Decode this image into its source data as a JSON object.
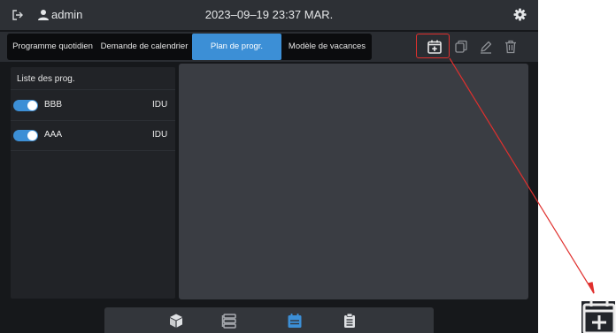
{
  "header": {
    "username": "admin",
    "datetime": "2023–09–19 23:37 MAR."
  },
  "tabs": [
    {
      "label": "Programme quotidien"
    },
    {
      "label": "Demande de calendrier"
    },
    {
      "label": "Plan de progr.",
      "active": true
    },
    {
      "label": "Modèle de vacances"
    }
  ],
  "toolbar": {
    "icons": [
      "calendar-add-icon",
      "copy-icon",
      "edit-icon",
      "delete-icon"
    ],
    "highlighted": "calendar-add-icon"
  },
  "program_list": {
    "title": "Liste des prog.",
    "items": [
      {
        "name": "BBB",
        "type": "IDU",
        "enabled": true
      },
      {
        "name": "AAA",
        "type": "IDU",
        "enabled": true
      }
    ]
  },
  "bottom_nav": {
    "icons": [
      "cube-icon",
      "stack-icon",
      "calendar-icon",
      "clipboard-icon"
    ],
    "active": "calendar-icon"
  },
  "colors": {
    "accent": "#3c8fd6",
    "callout": "#e0302e",
    "background": "#16181b",
    "panel": "#3a3d43"
  }
}
